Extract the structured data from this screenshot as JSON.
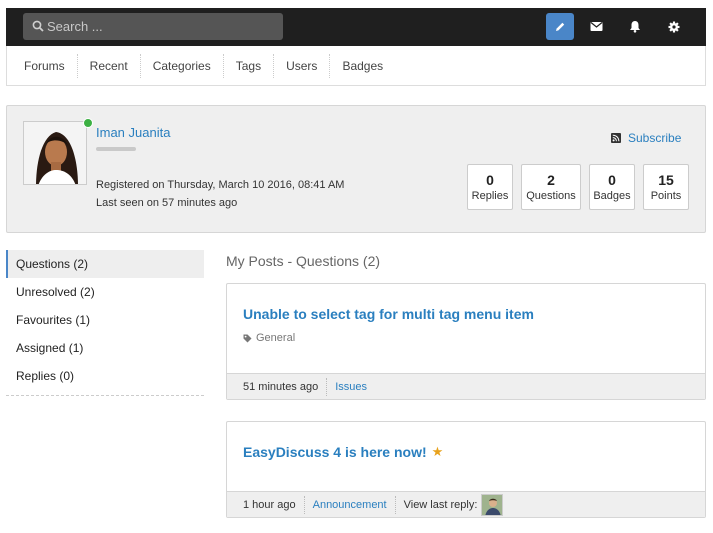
{
  "topbar": {
    "search_placeholder": "Search ...",
    "icons": [
      "pencil-icon",
      "envelope-icon",
      "bell-icon",
      "gear-icon"
    ],
    "accent": "#4a86c8"
  },
  "nav": {
    "items": [
      "Forums",
      "Recent",
      "Categories",
      "Tags",
      "Users",
      "Badges"
    ]
  },
  "profile": {
    "name": "Iman Juanita",
    "online": true,
    "registered": "Registered on Thursday, March 10 2016, 08:41 AM",
    "last_seen": "Last seen on 57 minutes ago",
    "subscribe": "Subscribe",
    "stats": [
      {
        "value": "0",
        "label": "Replies"
      },
      {
        "value": "2",
        "label": "Questions"
      },
      {
        "value": "0",
        "label": "Badges"
      },
      {
        "value": "15",
        "label": "Points"
      }
    ]
  },
  "sidebar": {
    "items": [
      "Questions (2)",
      "Unresolved (2)",
      "Favourites (1)",
      "Assigned (1)",
      "Replies (0)"
    ],
    "active": "Questions (2)"
  },
  "section_title": "My Posts - Questions (2)",
  "posts": [
    {
      "title": "Unable to select tag for multi tag menu item",
      "tag": "General",
      "time": "51 minutes ago",
      "category": "Issues"
    },
    {
      "title": "EasyDiscuss 4 is here now!",
      "featured": true,
      "time": "1 hour ago",
      "category": "Announcement",
      "last_reply_label": "View last reply:"
    }
  ],
  "colors": {
    "link": "#2a7fbf",
    "online": "#3cb043",
    "star": "#e8a21c",
    "topbar": "#1f1f1f"
  }
}
